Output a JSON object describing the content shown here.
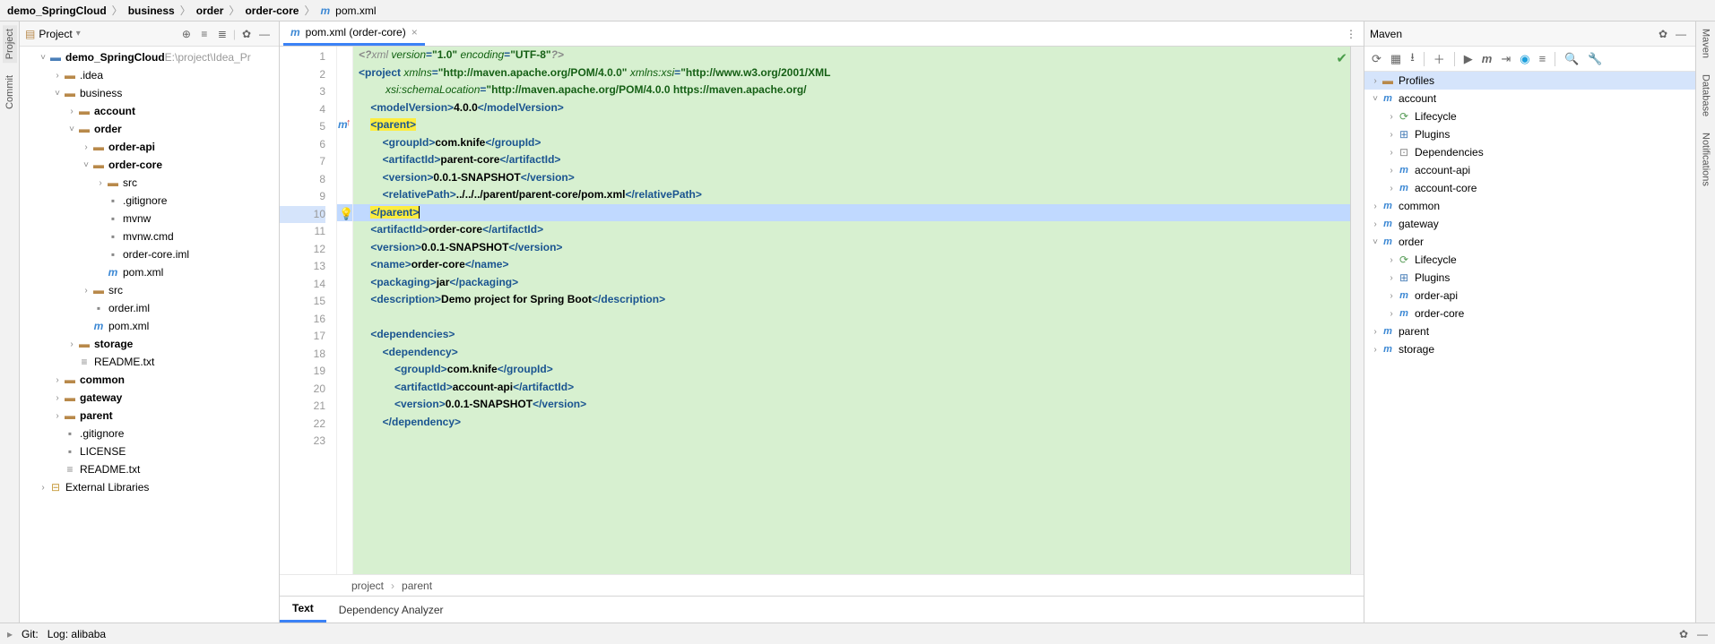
{
  "breadcrumb": [
    "demo_SpringCloud",
    "business",
    "order",
    "order-core",
    "pom.xml"
  ],
  "project_panel": {
    "title": "Project",
    "root": {
      "name": "demo_SpringCloud",
      "path": "E:\\project\\Idea_Pr"
    },
    "tree": [
      {
        "d": 1,
        "chev": "v",
        "icon": "module",
        "label": "demo_SpringCloud",
        "extra": "E:\\project\\Idea_Pr",
        "bold": true
      },
      {
        "d": 2,
        "chev": ">",
        "icon": "folder",
        "label": ".idea"
      },
      {
        "d": 2,
        "chev": "v",
        "icon": "folder",
        "label": "business"
      },
      {
        "d": 3,
        "chev": ">",
        "icon": "folder",
        "label": "account",
        "bold": true
      },
      {
        "d": 3,
        "chev": "v",
        "icon": "folder",
        "label": "order",
        "bold": true
      },
      {
        "d": 4,
        "chev": ">",
        "icon": "folder",
        "label": "order-api",
        "bold": true
      },
      {
        "d": 4,
        "chev": "v",
        "icon": "folder",
        "label": "order-core",
        "bold": true
      },
      {
        "d": 5,
        "chev": ">",
        "icon": "folder",
        "label": "src"
      },
      {
        "d": 5,
        "chev": "",
        "icon": "file",
        "label": ".gitignore"
      },
      {
        "d": 5,
        "chev": "",
        "icon": "file",
        "label": "mvnw"
      },
      {
        "d": 5,
        "chev": "",
        "icon": "file",
        "label": "mvnw.cmd"
      },
      {
        "d": 5,
        "chev": "",
        "icon": "file",
        "label": "order-core.iml"
      },
      {
        "d": 5,
        "chev": "",
        "icon": "maven",
        "label": "pom.xml"
      },
      {
        "d": 4,
        "chev": ">",
        "icon": "folder",
        "label": "src"
      },
      {
        "d": 4,
        "chev": "",
        "icon": "file",
        "label": "order.iml"
      },
      {
        "d": 4,
        "chev": "",
        "icon": "maven",
        "label": "pom.xml"
      },
      {
        "d": 3,
        "chev": ">",
        "icon": "folder",
        "label": "storage",
        "bold": true
      },
      {
        "d": 3,
        "chev": "",
        "icon": "txt",
        "label": "README.txt"
      },
      {
        "d": 2,
        "chev": ">",
        "icon": "folder",
        "label": "common",
        "bold": true
      },
      {
        "d": 2,
        "chev": ">",
        "icon": "folder",
        "label": "gateway",
        "bold": true
      },
      {
        "d": 2,
        "chev": ">",
        "icon": "folder",
        "label": "parent",
        "bold": true
      },
      {
        "d": 2,
        "chev": "",
        "icon": "file",
        "label": ".gitignore"
      },
      {
        "d": 2,
        "chev": "",
        "icon": "file",
        "label": "LICENSE"
      },
      {
        "d": 2,
        "chev": "",
        "icon": "txt",
        "label": "README.txt"
      },
      {
        "d": 1,
        "chev": ">",
        "icon": "lib",
        "label": "External Libraries"
      }
    ]
  },
  "editor": {
    "tab_label": "pom.xml (order-core)",
    "lines": [
      {
        "n": 1,
        "html": "<span class='t-declkey'>&lt;?</span><span class='t-decl'>xml </span><span class='t-attr'>version</span><span class='t-tag'>=</span><span class='t-val'>\"1.0\"</span><span class='t-decl'> </span><span class='t-attr'>encoding</span><span class='t-tag'>=</span><span class='t-val'>\"UTF-8\"</span><span class='t-declkey'>?&gt;</span>"
      },
      {
        "n": 2,
        "html": "<span class='t-tag'>&lt;project </span><span class='t-attr'>xmlns</span><span class='t-tag'>=</span><span class='t-val'>\"http://maven.apache.org/POM/4.0.0\"</span> <span class='t-attr'>xmlns:xsi</span><span class='t-tag'>=</span><span class='t-val'>\"http://www.w3.org/2001/XML</span>"
      },
      {
        "n": 3,
        "html": "         <span class='t-attr'>xsi:schemaLocation</span><span class='t-tag'>=</span><span class='t-val'>\"http://maven.apache.org/POM/4.0.0 https://maven.apache.org/</span>"
      },
      {
        "n": 4,
        "html": "    <span class='t-tag'>&lt;modelVersion&gt;</span><span class='t-text'>4.0.0</span><span class='t-tag'>&lt;/modelVersion&gt;</span>"
      },
      {
        "n": 5,
        "html": "    <span class='hl-yellow'><span class='t-tag'>&lt;parent&gt;</span></span>",
        "marker": "m-up"
      },
      {
        "n": 6,
        "html": "        <span class='t-tag'>&lt;groupId&gt;</span><span class='t-text'>com.knife</span><span class='t-tag'>&lt;/groupId&gt;</span>"
      },
      {
        "n": 7,
        "html": "        <span class='t-tag'>&lt;artifactId&gt;</span><span class='t-text'>parent-core</span><span class='t-tag'>&lt;/artifactId&gt;</span>"
      },
      {
        "n": 8,
        "html": "        <span class='t-tag'>&lt;version&gt;</span><span class='t-text'>0.0.1-SNAPSHOT</span><span class='t-tag'>&lt;/version&gt;</span>"
      },
      {
        "n": 9,
        "html": "        <span class='t-tag'>&lt;relativePath&gt;</span><span class='t-text'>../../../parent/parent-core/pom.xml</span><span class='t-tag'>&lt;/relativePath&gt;</span>"
      },
      {
        "n": 10,
        "html": "    <span class='hl-yellow'><span class='t-tag'>&lt;/parent&gt;</span></span><span class='caret'></span>",
        "current": true,
        "marker": "bulb"
      },
      {
        "n": 11,
        "html": "    <span class='t-tag'>&lt;artifactId&gt;</span><span class='t-text'>order-core</span><span class='t-tag'>&lt;/artifactId&gt;</span>"
      },
      {
        "n": 12,
        "html": "    <span class='t-tag'>&lt;version&gt;</span><span class='t-text'>0.0.1-SNAPSHOT</span><span class='t-tag'>&lt;/version&gt;</span>"
      },
      {
        "n": 13,
        "html": "    <span class='t-tag'>&lt;name&gt;</span><span class='t-text'>order-core</span><span class='t-tag'>&lt;/name&gt;</span>"
      },
      {
        "n": 14,
        "html": "    <span class='t-tag'>&lt;packaging&gt;</span><span class='t-text'>jar</span><span class='t-tag'>&lt;/packaging&gt;</span>"
      },
      {
        "n": 15,
        "html": "    <span class='t-tag'>&lt;description&gt;</span><span class='t-text'>Demo project for Spring Boot</span><span class='t-tag'>&lt;/description&gt;</span>"
      },
      {
        "n": 16,
        "html": ""
      },
      {
        "n": 17,
        "html": "    <span class='t-tag'>&lt;dependencies&gt;</span>"
      },
      {
        "n": 18,
        "html": "        <span class='t-tag'>&lt;dependency&gt;</span>"
      },
      {
        "n": 19,
        "html": "            <span class='t-tag'>&lt;groupId&gt;</span><span class='t-text'>com.knife</span><span class='t-tag'>&lt;/groupId&gt;</span>"
      },
      {
        "n": 20,
        "html": "            <span class='t-tag'>&lt;artifactId&gt;</span><span class='t-text'>account-api</span><span class='t-tag'>&lt;/artifactId&gt;</span>"
      },
      {
        "n": 21,
        "html": "            <span class='t-tag'>&lt;version&gt;</span><span class='t-text'>0.0.1-SNAPSHOT</span><span class='t-tag'>&lt;/version&gt;</span>"
      },
      {
        "n": 22,
        "html": "        <span class='t-tag'>&lt;/dependency&gt;</span>"
      },
      {
        "n": 23,
        "html": ""
      }
    ],
    "crumb": [
      "project",
      "parent"
    ],
    "lower_tabs": [
      "Text",
      "Dependency Analyzer"
    ]
  },
  "maven": {
    "title": "Maven",
    "tree": [
      {
        "d": 0,
        "chev": ">",
        "icon": "prof",
        "label": "Profiles",
        "sel": true
      },
      {
        "d": 0,
        "chev": "v",
        "icon": "mod",
        "label": "account"
      },
      {
        "d": 1,
        "chev": ">",
        "icon": "life",
        "label": "Lifecycle"
      },
      {
        "d": 1,
        "chev": ">",
        "icon": "plug",
        "label": "Plugins"
      },
      {
        "d": 1,
        "chev": ">",
        "icon": "dep",
        "label": "Dependencies"
      },
      {
        "d": 1,
        "chev": ">",
        "icon": "mod",
        "label": "account-api"
      },
      {
        "d": 1,
        "chev": ">",
        "icon": "mod",
        "label": "account-core"
      },
      {
        "d": 0,
        "chev": ">",
        "icon": "mod",
        "label": "common"
      },
      {
        "d": 0,
        "chev": ">",
        "icon": "mod",
        "label": "gateway"
      },
      {
        "d": 0,
        "chev": "v",
        "icon": "mod",
        "label": "order"
      },
      {
        "d": 1,
        "chev": ">",
        "icon": "life",
        "label": "Lifecycle"
      },
      {
        "d": 1,
        "chev": ">",
        "icon": "plug",
        "label": "Plugins"
      },
      {
        "d": 1,
        "chev": ">",
        "icon": "mod",
        "label": "order-api"
      },
      {
        "d": 1,
        "chev": ">",
        "icon": "mod",
        "label": "order-core"
      },
      {
        "d": 0,
        "chev": ">",
        "icon": "mod",
        "label": "parent"
      },
      {
        "d": 0,
        "chev": ">",
        "icon": "mod",
        "label": "storage"
      }
    ]
  },
  "left_tabs": [
    "Project",
    "Commit"
  ],
  "right_tabs": [
    "Maven",
    "Database",
    "Notifications"
  ],
  "status": {
    "git": "Git:",
    "log": "Log: alibaba"
  }
}
